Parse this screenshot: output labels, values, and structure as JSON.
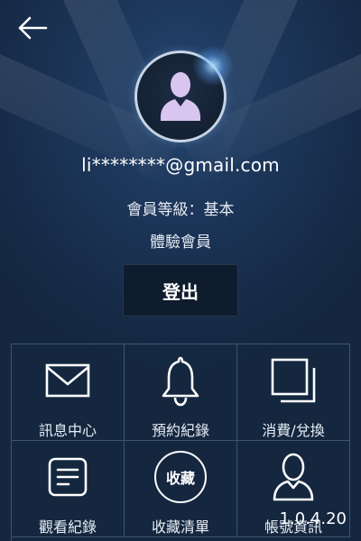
{
  "header": {
    "back_icon": "arrow-left-icon"
  },
  "profile": {
    "avatar_icon": "user-silhouette-icon",
    "email": "li********@gmail.com",
    "member_level": "會員等級：基本",
    "member_type": "體驗會員",
    "logout_label": "登出"
  },
  "menu": {
    "items": [
      {
        "label": "訊息中心",
        "icon": "envelope-icon"
      },
      {
        "label": "預約紀錄",
        "icon": "bell-icon"
      },
      {
        "label": "消費/兌換",
        "icon": "stacked-squares-icon"
      },
      {
        "label": "觀看紀錄",
        "icon": "document-icon"
      },
      {
        "label": "收藏清單",
        "icon": "favorite-circle-icon",
        "icon_text": "收藏"
      },
      {
        "label": "帳號資訊",
        "icon": "user-outline-icon"
      }
    ]
  },
  "footer": {
    "version": "1.0.4.20"
  },
  "colors": {
    "background": "#1a3152",
    "logout_button": "#0f1c2d",
    "avatar_fill": "#d9c6f0",
    "grid_line": "#3b5675"
  }
}
